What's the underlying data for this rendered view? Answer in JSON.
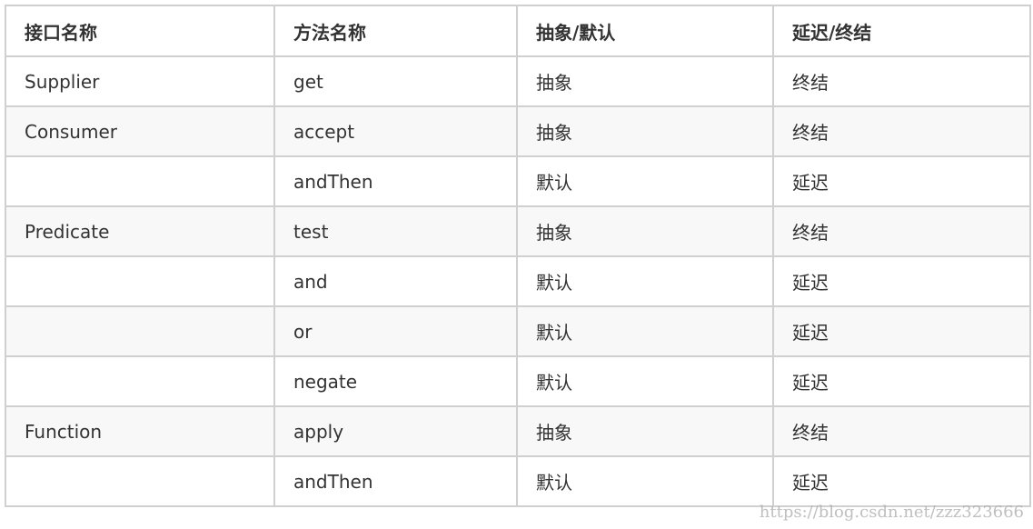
{
  "table": {
    "headers": [
      "接口名称",
      "方法名称",
      "抽象/默认",
      "延迟/终结"
    ],
    "rows": [
      [
        "Supplier",
        "get",
        "抽象",
        "终结"
      ],
      [
        "Consumer",
        "accept",
        "抽象",
        "终结"
      ],
      [
        "",
        "andThen",
        "默认",
        "延迟"
      ],
      [
        "Predicate",
        "test",
        "抽象",
        "终结"
      ],
      [
        "",
        "and",
        "默认",
        "延迟"
      ],
      [
        "",
        "or",
        "默认",
        "延迟"
      ],
      [
        "",
        "negate",
        "默认",
        "延迟"
      ],
      [
        "Function",
        "apply",
        "抽象",
        "终结"
      ],
      [
        "",
        "andThen",
        "默认",
        "延迟"
      ]
    ]
  },
  "watermark": "https://blog.csdn.net/zzz323666"
}
